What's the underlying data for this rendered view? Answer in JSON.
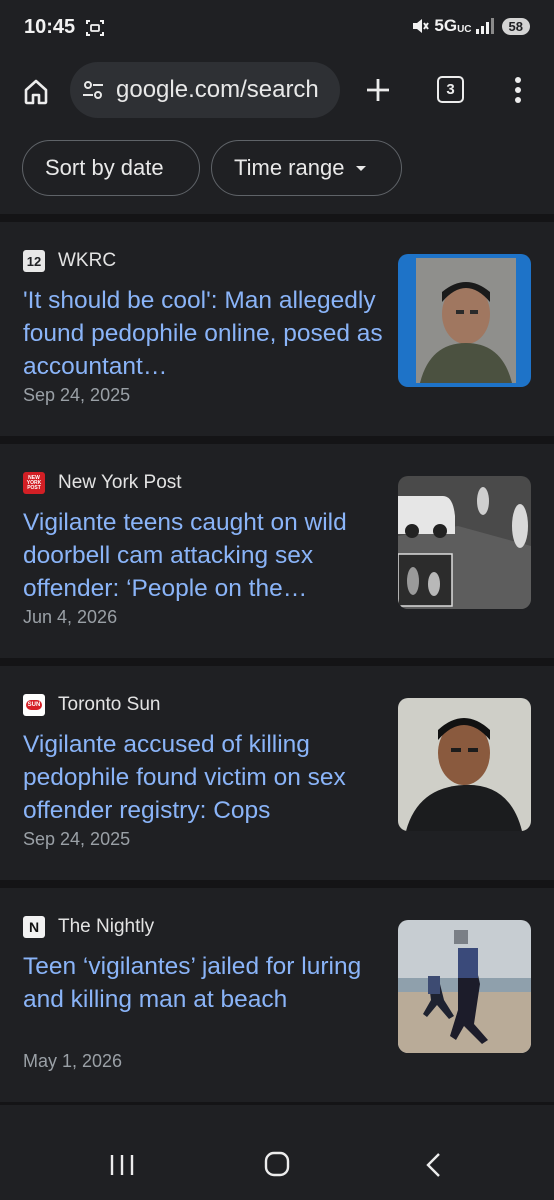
{
  "status_bar": {
    "time": "10:45",
    "network": "5G",
    "network_sub": "UC",
    "battery": "58"
  },
  "browser": {
    "url": "google.com/search",
    "tab_count": "3"
  },
  "filters": {
    "sort_label": "Sort by date",
    "time_label": "Time range"
  },
  "results": [
    {
      "source": "WKRC",
      "logo_text": "12",
      "headline": "'It should be cool': Man allegedly found pedophile online, posed as accountant…",
      "date": "Sep 24, 2025"
    },
    {
      "source": "New York Post",
      "logo_text": "NEW YORK POST",
      "headline": "Vigilante teens caught on wild doorbell cam attacking sex offender: ‘People on the…",
      "date": "Jun 4, 2026"
    },
    {
      "source": "Toronto Sun",
      "logo_text": "SUN",
      "headline": "Vigilante accused of killing pedophile found victim on sex offender registry: Cops",
      "date": "Sep 24, 2025"
    },
    {
      "source": "The Nightly",
      "logo_text": "N",
      "headline": "Teen ‘vigilantes’ jailed for luring and killing man at beach",
      "date": "May 1, 2026"
    }
  ],
  "colors": {
    "link": "#8ab4f8",
    "background": "#1f2023",
    "separator": "#141416",
    "muted_text": "#9aa0a6"
  },
  "icons": [
    "screenshot-icon",
    "mute-icon",
    "signal-icon",
    "home-icon",
    "tune-icon",
    "plus-icon",
    "more-vert-icon",
    "recents-icon",
    "nav-home-icon",
    "back-icon"
  ]
}
